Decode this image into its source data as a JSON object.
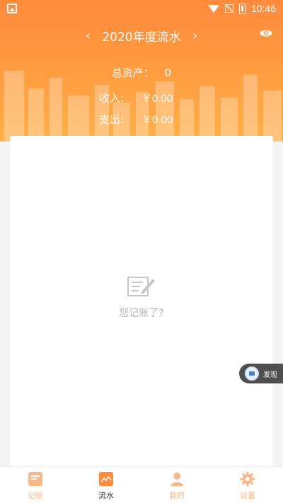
{
  "status_bar": {
    "time": "10:46"
  },
  "header": {
    "title": "2020年度流水",
    "prev_label": "‹",
    "next_label": "›",
    "total_assets_label": "总资产：",
    "total_assets_value": "0",
    "income_label": "收入:",
    "income_value": "￥0.00",
    "expense_label": "支出:",
    "expense_value": "￥0.00"
  },
  "empty_state": {
    "text": "您记账了?"
  },
  "floating": {
    "discover_label": "发现"
  },
  "tabs": [
    {
      "label": "记账",
      "icon": "notebook-icon"
    },
    {
      "label": "流水",
      "icon": "chart-line-icon"
    },
    {
      "label": "我的",
      "icon": "person-icon"
    },
    {
      "label": "设置",
      "icon": "gear-icon"
    }
  ],
  "colors": {
    "accent": "#ff8a3c",
    "tab_icon": "#f8b98a",
    "active_icon": "#ff8a3c"
  }
}
